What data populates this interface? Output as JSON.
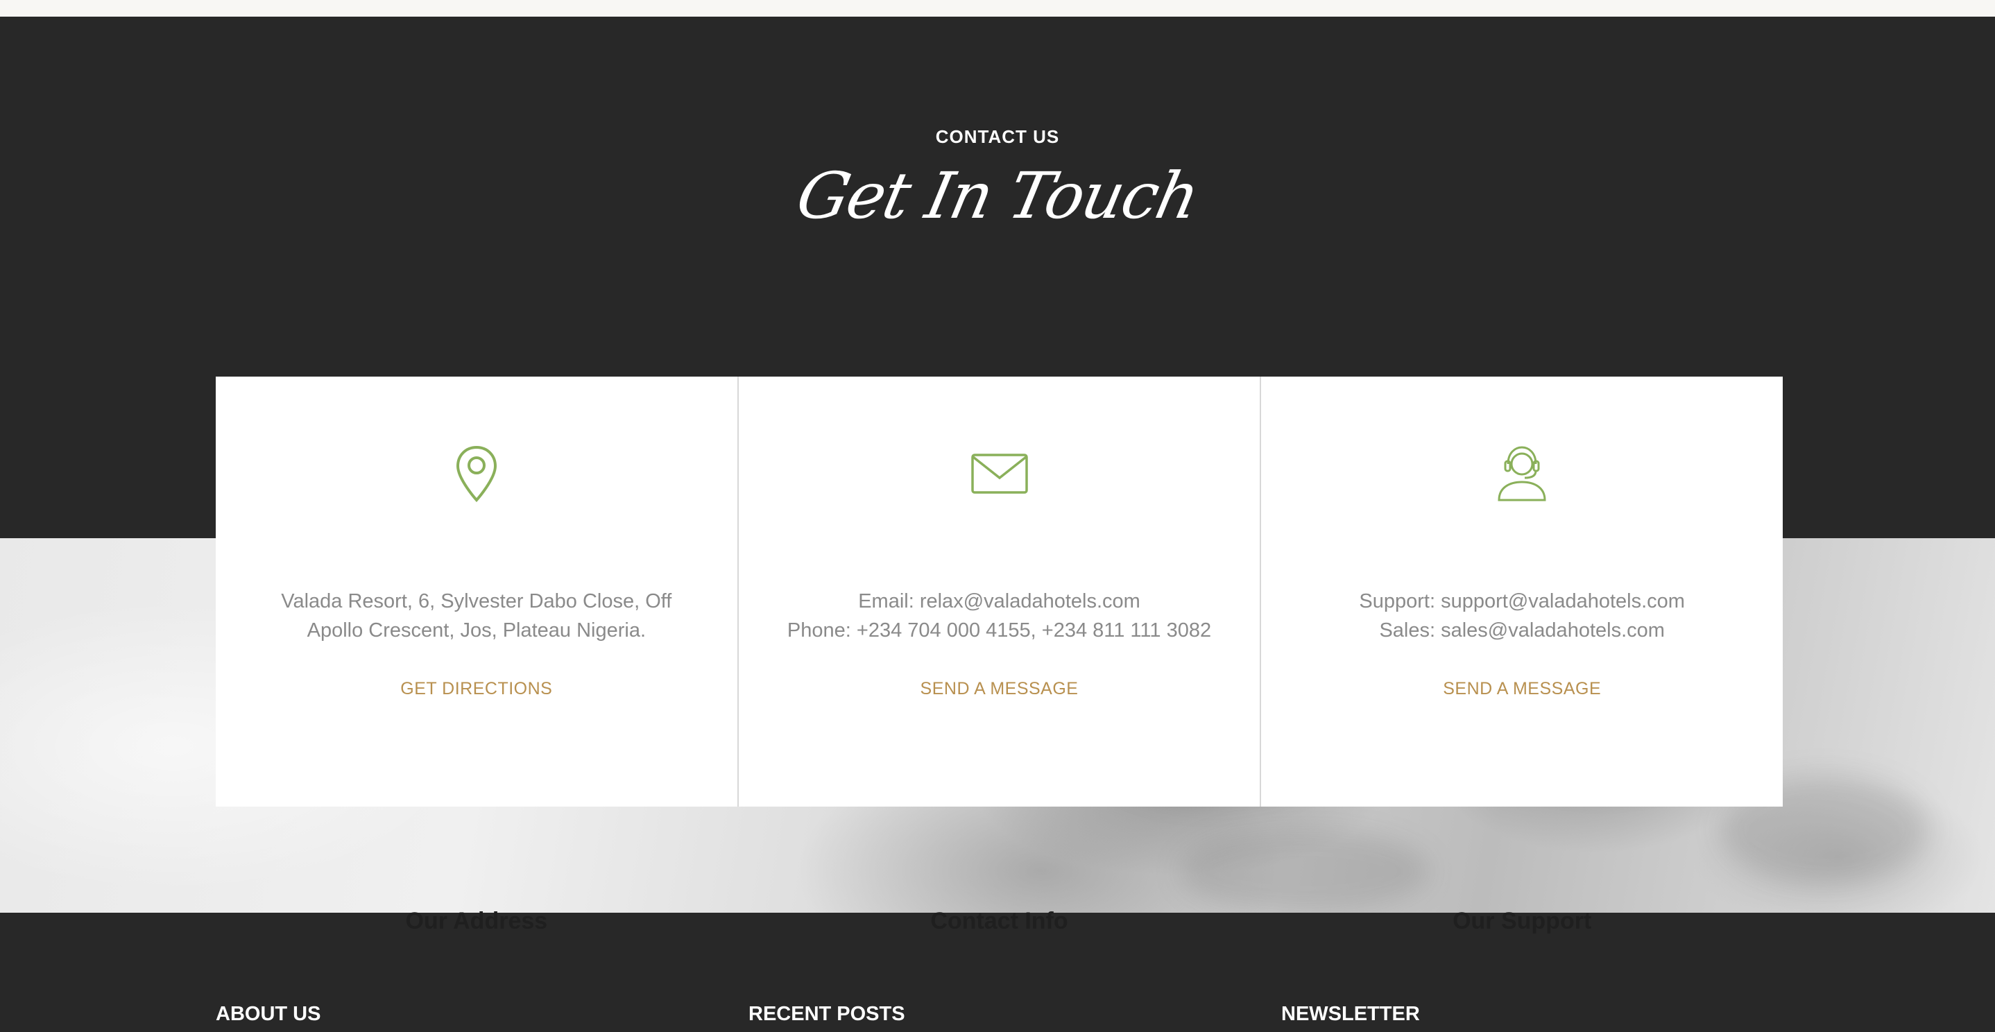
{
  "contact_section": {
    "eyebrow": "CONTACT US",
    "title": "Get In Touch"
  },
  "cards": [
    {
      "icon": "map-pin-icon",
      "title": "Our Address",
      "lines": [
        "Valada Resort, 6, Sylvester Dabo Close, Off",
        "Apollo Crescent, Jos, Plateau Nigeria."
      ],
      "link": "GET DIRECTIONS"
    },
    {
      "icon": "envelope-icon",
      "title": "Contact Info",
      "lines": [
        "Email: relax@valadahotels.com",
        "Phone: +234 704 000 4155, +234 811 111 3082"
      ],
      "link": "SEND A MESSAGE"
    },
    {
      "icon": "support-agent-icon",
      "title": "Our Support",
      "lines": [
        "Support: support@valadahotels.com",
        "Sales: sales@valadahotels.com"
      ],
      "link": "SEND A MESSAGE"
    }
  ],
  "footer": {
    "headings": [
      "ABOUT US",
      "RECENT POSTS",
      "NEWSLETTER"
    ]
  },
  "colors": {
    "accent_link": "#b8904f",
    "icon_green": "#8ab05a",
    "dark_bg": "#282828"
  }
}
